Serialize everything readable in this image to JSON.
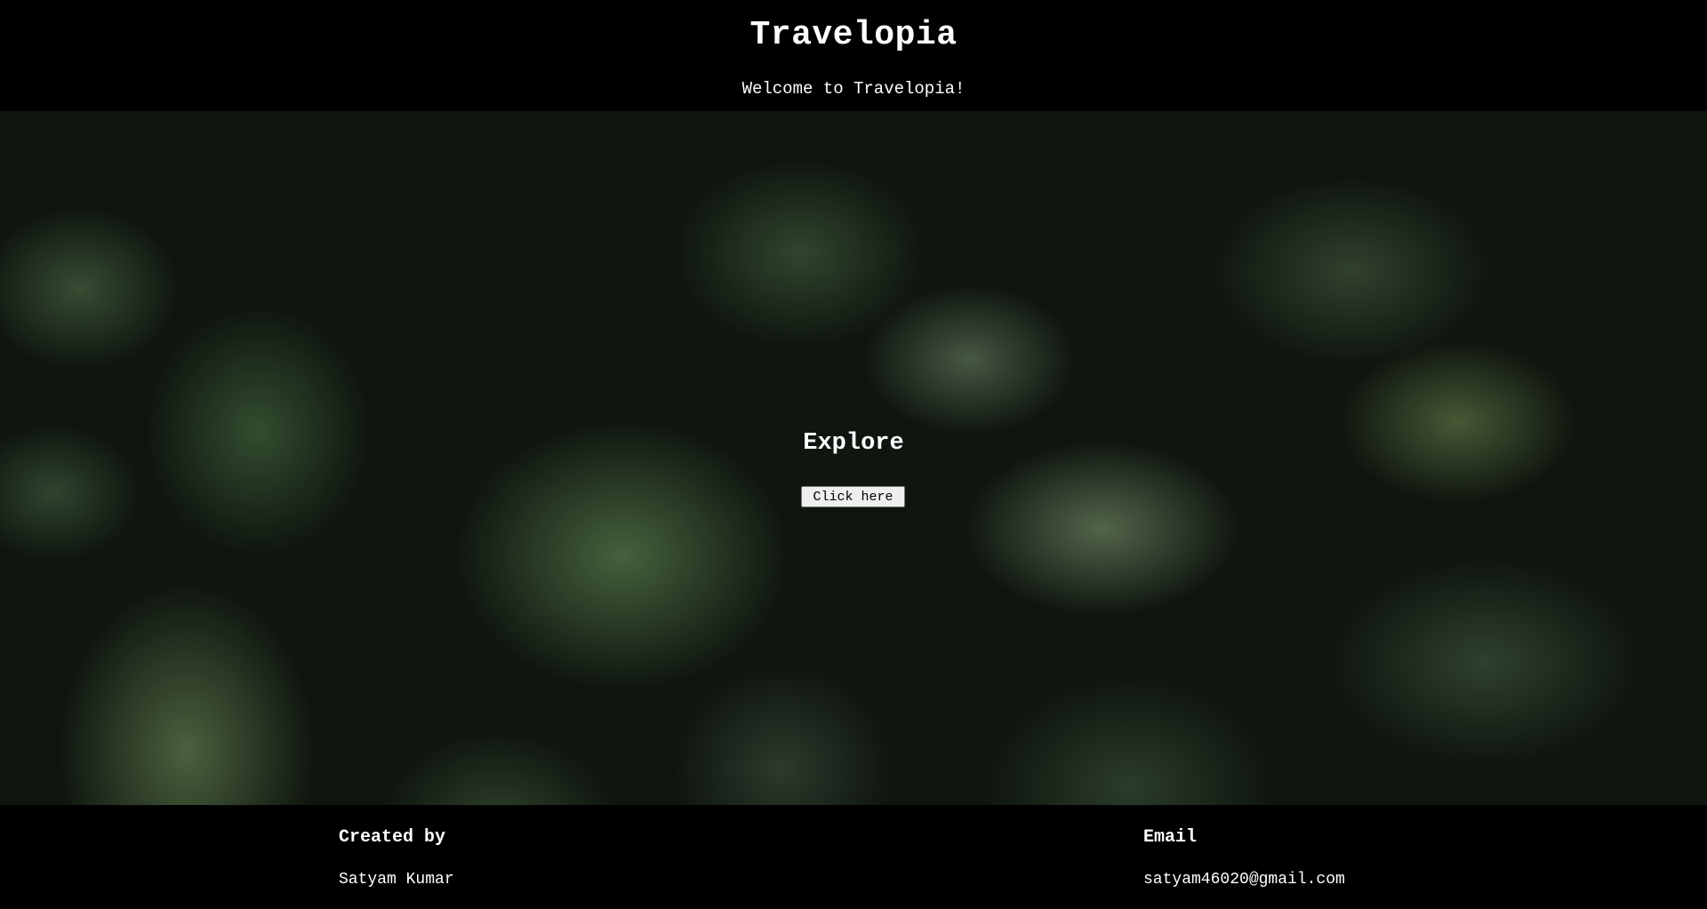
{
  "header": {
    "title": "Travelopia",
    "subtitle": "Welcome to Travelopia!"
  },
  "hero": {
    "background": "dark green leaves with water droplets",
    "heading": "Explore",
    "button_label": "Click here"
  },
  "footer": {
    "created_by_heading": "Created by",
    "created_by_value": "Satyam Kumar",
    "email_heading": "Email",
    "email_value": "satyam46020@gmail.com"
  },
  "colors": {
    "page_background": "#000000",
    "text": "#ffffff",
    "button_background": "#efefef"
  }
}
